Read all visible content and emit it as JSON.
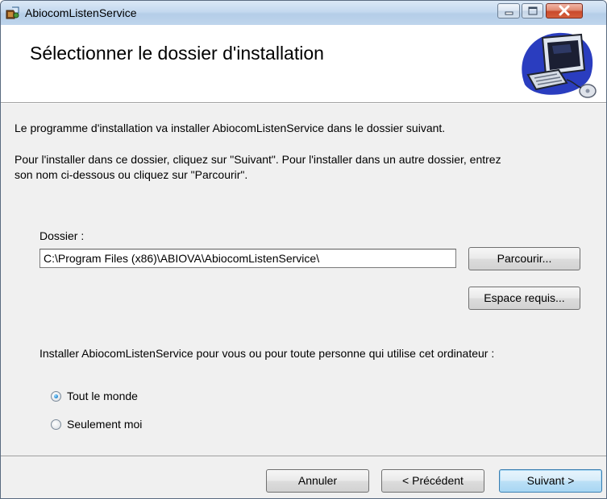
{
  "window": {
    "title": "AbiocomListenService",
    "controls": {
      "minimize": "minimize",
      "maximize": "maximize",
      "close": "close"
    }
  },
  "header": {
    "title": "Sélectionner le dossier d'installation"
  },
  "body": {
    "intro": "Le programme d'installation va installer AbiocomListenService dans le dossier suivant.",
    "instructions_line1": "Pour l'installer dans ce dossier, cliquez sur \"Suivant\". Pour l'installer dans un autre dossier, entrez",
    "instructions_line2": "son nom ci-dessous ou cliquez sur \"Parcourir\".",
    "folder_label": "Dossier :",
    "folder_value": "C:\\Program Files (x86)\\ABIOVA\\AbiocomListenService\\",
    "browse_label": "Parcourir...",
    "disk_cost_label": "Espace requis...",
    "install_for_prompt": "Installer AbiocomListenService pour vous ou pour toute personne qui utilise cet ordinateur :",
    "options": [
      {
        "label": "Tout le monde",
        "selected": true
      },
      {
        "label": "Seulement moi",
        "selected": false
      }
    ]
  },
  "footer": {
    "cancel_label": "Annuler",
    "back_label": "< Précédent",
    "next_label": "Suivant >"
  },
  "colors": {
    "title_bar": "#c4d9ef",
    "dialog_bg": "#f0f0f0",
    "default_button_border": "#3c7fb1",
    "close_button": "#c94a2b"
  }
}
